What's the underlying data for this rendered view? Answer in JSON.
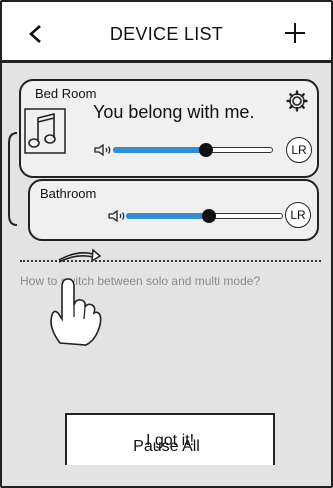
{
  "header": {
    "title": "DEVICE LIST",
    "back_icon": "chevron-left-icon",
    "add_icon": "plus-icon"
  },
  "devices": [
    {
      "name": "Bed Room",
      "song": "You belong with me.",
      "volume": 0.58,
      "channel": "LR"
    },
    {
      "name": "Bathroom",
      "volume": 0.53,
      "channel": "LR"
    }
  ],
  "tutorial": {
    "question": "How to switch between solo and multi mode?"
  },
  "buttons": {
    "got_it": "I got it!",
    "pause_all": "Pause All"
  },
  "colors": {
    "accent": "#2f8fcf",
    "background": "#e3e3e3"
  }
}
